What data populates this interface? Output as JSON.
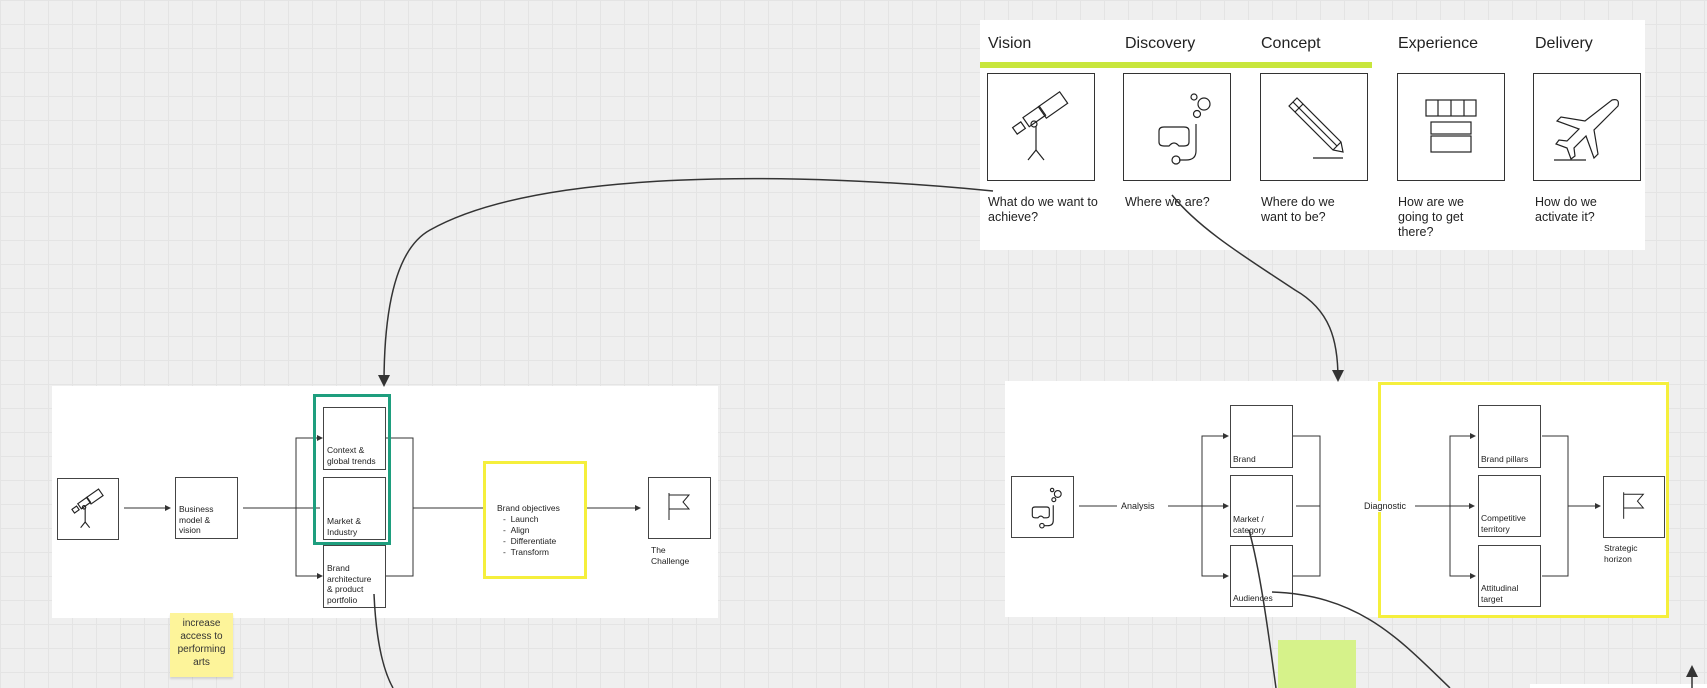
{
  "process": {
    "stages": [
      {
        "label": "Vision",
        "question": "What do we want to achieve?",
        "icon": "telescope-icon"
      },
      {
        "label": "Discovery",
        "question": "Where we are?",
        "icon": "snorkel-mask-icon"
      },
      {
        "label": "Concept",
        "question": "Where do we want to be?",
        "icon": "pencil-icon"
      },
      {
        "label": "Experience",
        "question": "How are we going to get there?",
        "icon": "layers-icon"
      },
      {
        "label": "Delivery",
        "question": "How do we activate it?",
        "icon": "airplane-icon"
      }
    ],
    "accent": "#c8e63c"
  },
  "vision_diagram": {
    "business_model": "Business model & vision",
    "context": "Context & global trends",
    "market": "Market & Industry",
    "brand_architecture": "Brand architecture & product portfolio",
    "objectives_title": "Brand objectives",
    "objectives": [
      "Launch",
      "Align",
      "Differentiate",
      "Transform"
    ],
    "challenge": "The Challenge",
    "highlight_green": "#1e9e7e",
    "highlight_yellow": "#f5ef3c"
  },
  "discovery_diagram": {
    "analysis": "Analysis",
    "diagnostic": "Diagnostic",
    "brand": "Brand",
    "market": "Market / category",
    "audiences": "Audiences",
    "pillars": "Brand pillars",
    "territory": "Competitive territory",
    "target": "Attitudinal target",
    "horizon": "Strategic horizon"
  },
  "stickies": [
    {
      "text": "increase access to performing arts",
      "color": "#fdf49a"
    },
    {
      "text": "",
      "color": "#d6f28a"
    }
  ]
}
